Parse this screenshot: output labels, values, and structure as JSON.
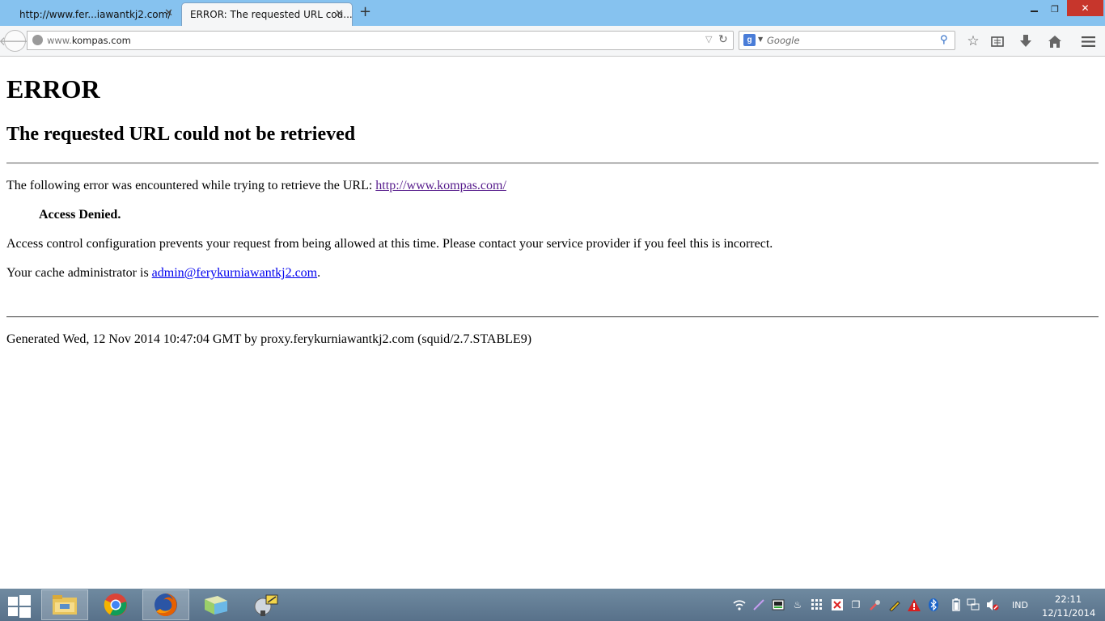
{
  "browser": {
    "tabs": [
      {
        "label": "http://www.fer...iawantkj2.com/",
        "active": false
      },
      {
        "label": "ERROR: The requested URL cou...",
        "active": true
      }
    ],
    "new_tab_label": "+",
    "address": {
      "prefix": "www.",
      "domain": "kompas.com"
    },
    "search": {
      "engine": "Google",
      "placeholder": "Google"
    },
    "icons": [
      "back-arrow-icon",
      "globe-icon",
      "dropmarker-icon",
      "reload-icon",
      "google-icon",
      "magnifier-icon",
      "bookmark-star-icon",
      "reading-list-icon",
      "downloads-icon",
      "home-icon",
      "menu-icon"
    ]
  },
  "page": {
    "title": "ERROR",
    "subtitle": "The requested URL could not be retrieved",
    "line1_text": "The following error was encountered while trying to retrieve the URL: ",
    "line1_link": "http://www.kompas.com/",
    "denied": "Access Denied.",
    "line3": "Access control configuration prevents your request from being allowed at this time. Please contact your service provider if you feel this is incorrect.",
    "line4_text": "Your cache administrator is ",
    "line4_link": "admin@ferykurniawantkj2.com",
    "line4_end": ".",
    "footer": "Generated Wed, 12 Nov 2014 10:47:04 GMT by proxy.ferykurniawantkj2.com (squid/2.7.STABLE9)"
  },
  "taskbar": {
    "apps": [
      "file-explorer-icon",
      "chrome-icon",
      "firefox-icon",
      "folder-icon",
      "app-icon"
    ],
    "language": "IND",
    "time": "22:11",
    "date": "12/11/2014"
  },
  "colors": {
    "titlebar": "#86c2ef",
    "close": "#c7362c",
    "link": "#551a8b",
    "mail_link": "#0000ee",
    "taskbar": "#6385a0"
  }
}
